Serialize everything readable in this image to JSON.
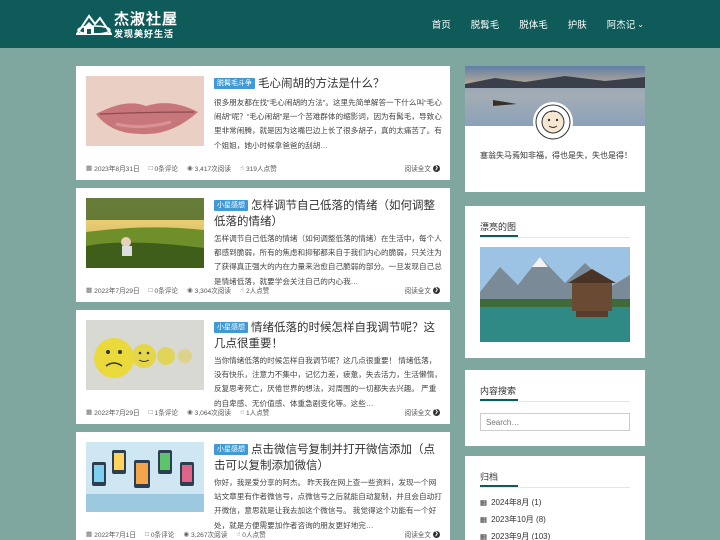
{
  "site": {
    "title": "杰淑社屋",
    "subtitle": "发现美好生活",
    "logo_icon": "house-mountain-logo"
  },
  "nav": {
    "items": [
      {
        "label": "首页"
      },
      {
        "label": "脱髯毛"
      },
      {
        "label": "脱体毛"
      },
      {
        "label": "护肤"
      },
      {
        "label": "阿杰记",
        "icon": "chevron-down-icon"
      }
    ]
  },
  "posts": [
    {
      "badge": "脱髯毛斗争",
      "title": "毛心闹胡的方法是什么？",
      "excerpt": "很多朋友都在找“毛心闹胡的方法”。这里先简单解答一下什么叫“毛心闹胡”呢？“毛心闹胡”是一个苦难群体的缩影词，因为有髯毛，导致心里非常闹腾，就是因为这嘴巴边上长了很多胡子，真的太痛苦了。有个姐姐，她小时候拿爸爸的刮胡…",
      "date": "2023年8月31日",
      "comments": "0条评论",
      "views": "3,417次阅读",
      "likes": "319人点赞",
      "more": "阅读全文"
    },
    {
      "badge": "小星感想",
      "title": "怎样调节自己低落的情绪（如何调整低落的情绪）",
      "excerpt": "怎样调节自己低落的情绪（如何调整低落的情绪）在生活中，每个人都感到脆弱，所有的焦虑和抑郁都来自于我们内心的脆弱，只关注为了获得真正强大的内在力量来治愈自己脆弱的部分。一旦发现自己总是情绪低落，就要学会关注自己的内心我…",
      "date": "2022年7月29日",
      "comments": "0条评论",
      "views": "3,304次阅读",
      "likes": "2人点赞",
      "more": "阅读全文"
    },
    {
      "badge": "小星感想",
      "title": "情绪低落的时候怎样自我调节呢？这几点很重要！",
      "excerpt": "当你情绪低落的时候怎样自我调节呢？这几点很重要！ 情绪低落，没有快乐，注意力不集中，记忆力差，疲惫，失去活力，生活懒惰，反复思考死亡，厌倦世界的想法，对周围的一切都失去兴趣。 严重的自卑感、无价值感、体重急剧变化等。这些…",
      "date": "2022年7月29日",
      "comments": "1条评论",
      "views": "3,064次阅读",
      "likes": "1人点赞",
      "more": "阅读全文"
    },
    {
      "badge": "小星感想",
      "title": "点击微信号复制并打开微信添加（点击可以复制添加微信）",
      "excerpt": "你好，我是爱分享的阿杰。 昨天我在网上查一些资料，发现一个网站文章里有作者微信号，点微信号之后就能自动复制，并且会自动打开微信，意思就是让我去加这个微信号。 我觉得这个功能有一个好处，就是方便需要加作者咨询的朋友更好地完…",
      "date": "2022年7月1日",
      "comments": "0条评论",
      "views": "3,267次阅读",
      "likes": "0人点赞",
      "more": "阅读全文"
    }
  ],
  "sidebar": {
    "profile_text": "塞翁失马焉知非福，得也是失，失也是得！",
    "gallery_title": "漂亮的图",
    "search_title": "内容搜索",
    "search_placeholder": "Search…",
    "archive_title": "归档",
    "archives": [
      {
        "label": "2024年8月",
        "count": "(1)"
      },
      {
        "label": "2023年10月",
        "count": "(8)"
      },
      {
        "label": "2023年9月",
        "count": "(103)"
      }
    ]
  },
  "colors": {
    "page_bg": "#7fa7a0",
    "header_bg": "#0f5b5a",
    "badge": "#3f9ad6"
  }
}
